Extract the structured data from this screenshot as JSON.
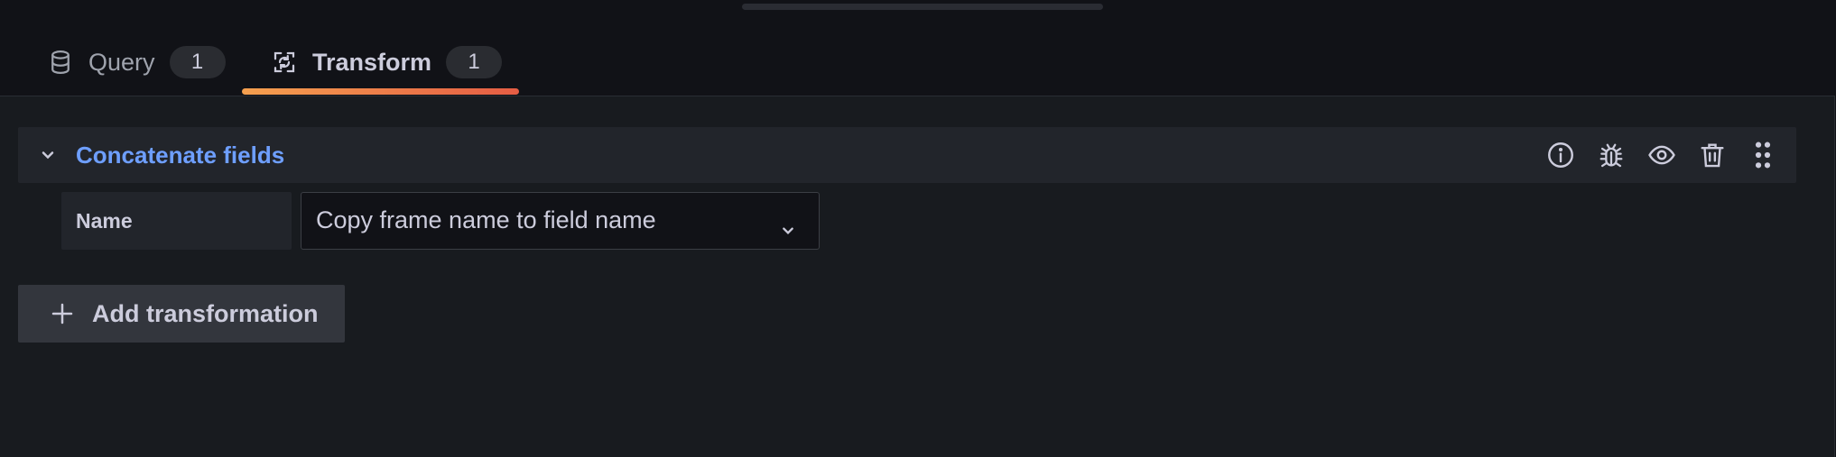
{
  "tabs": [
    {
      "label": "Query",
      "count": "1",
      "icon": "database-icon",
      "active": false
    },
    {
      "label": "Transform",
      "count": "1",
      "icon": "process-icon",
      "active": true
    }
  ],
  "transformation": {
    "title": "Concatenate fields",
    "actions": [
      "info-icon",
      "debug-icon",
      "eye-icon",
      "trash-icon",
      "drag-icon"
    ],
    "field": {
      "label": "Name",
      "value": "Copy frame name to field name"
    }
  },
  "add_button": {
    "label": "Add transformation",
    "icon": "plus-icon"
  },
  "colors": {
    "background": "#111217",
    "panel": "#181b1f",
    "title_link": "#6e9fff",
    "tab_underline_start": "#f5a04f",
    "tab_underline_end": "#e55d44"
  }
}
